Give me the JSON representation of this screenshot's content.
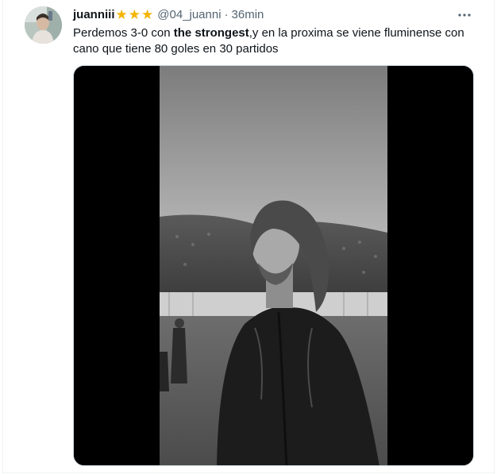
{
  "tweet": {
    "author": {
      "display_name": "juanniii",
      "handle": "@04_juanni",
      "star_count": 3,
      "star_icon": "star-emoji-icon",
      "avatar_icon": "user-avatar"
    },
    "separator": "·",
    "time": "36min",
    "text": {
      "part1": "Perdemos 3-0 con ",
      "bold": "the strongest",
      "part2": ",y en la proxima se viene fluminense con cano que tiene 80 goles en 30 partidos"
    },
    "media": {
      "type": "video",
      "icon": "video-frame"
    },
    "more_icon": "more-options-icon"
  },
  "colors": {
    "text": "#0f1419",
    "secondary": "#536471",
    "star": "#f4b400",
    "media_background": "#000000"
  }
}
